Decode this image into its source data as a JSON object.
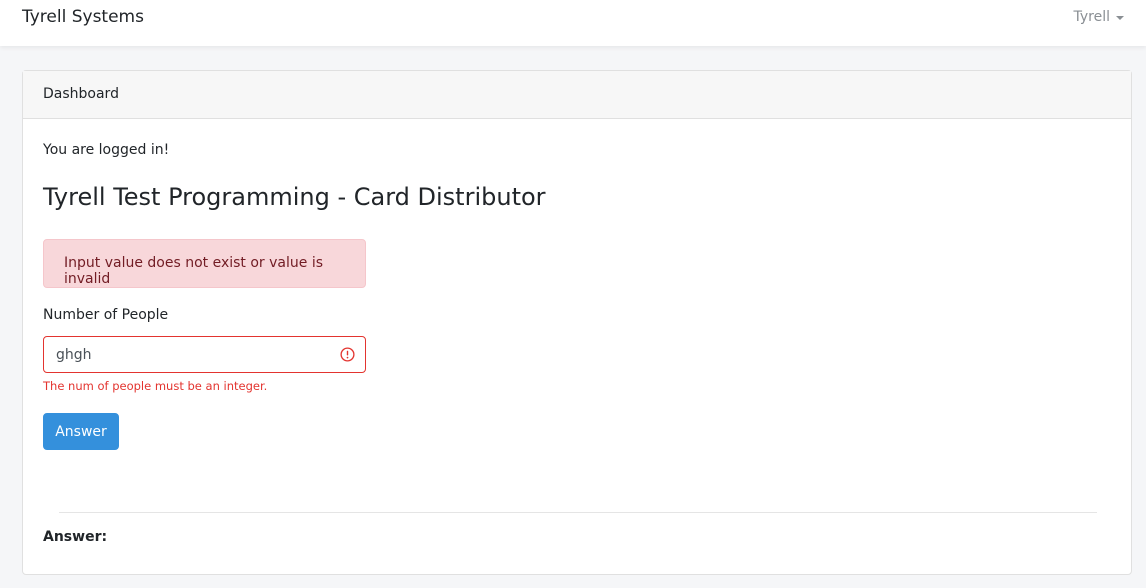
{
  "navbar": {
    "brand": "Tyrell Systems",
    "user": "Tyrell"
  },
  "card": {
    "header": "Dashboard",
    "status_message": "You are logged in!",
    "title": "Tyrell Test Programming - Card Distributor",
    "alert": "Input value does not exist or value is invalid",
    "form": {
      "label": "Number of People",
      "value": "ghgh",
      "error": "The num of people must be an integer.",
      "submit_label": "Answer"
    },
    "answer_label": "Answer:"
  },
  "colors": {
    "primary": "#3490dc",
    "danger": "#e3342f",
    "alert_bg": "#f8d7da",
    "alert_text": "#721c24"
  }
}
